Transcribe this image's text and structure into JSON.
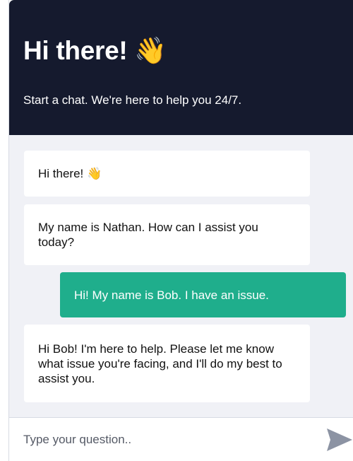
{
  "header": {
    "title": "Hi there! 👋",
    "subtitle": "Start a chat. We're here to help you 24/7."
  },
  "messages": [
    {
      "sender": "bot",
      "text": "Hi there! 👋"
    },
    {
      "sender": "bot",
      "text": "My name is Nathan. How can I assist you today?"
    },
    {
      "sender": "user",
      "text": "Hi! My name is Bob. I have an issue."
    },
    {
      "sender": "bot",
      "text": "Hi Bob! I'm here to help. Please let me know what issue you're facing, and I'll do my best to assist you."
    }
  ],
  "composer": {
    "placeholder": "Type your question..",
    "value": ""
  },
  "colors": {
    "header_background": "#151a2e",
    "user_bubble": "#1fae8c",
    "messages_background": "#f0f1f6",
    "send_icon": "#8c93a3"
  },
  "icons": {
    "send": "send-icon"
  }
}
